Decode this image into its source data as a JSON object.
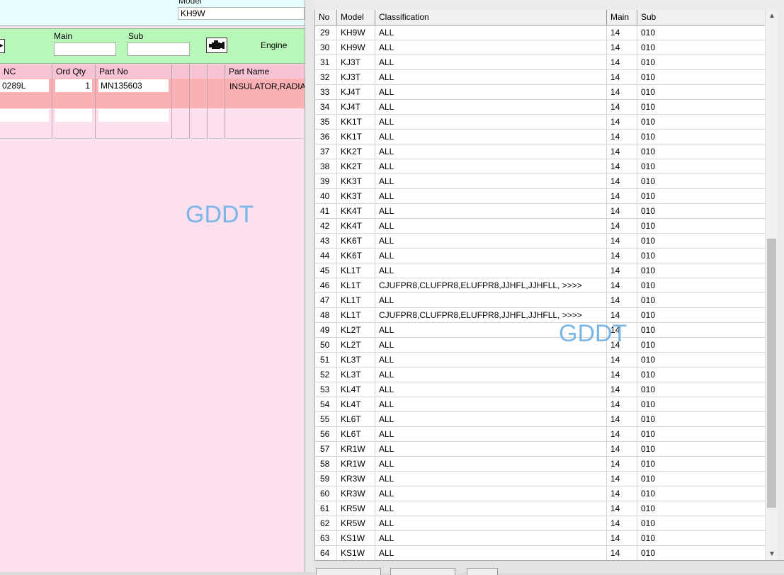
{
  "left": {
    "model_label": "Model",
    "model_value": "KH9W",
    "main_label": "Main",
    "sub_label": "Sub",
    "engine_label": "Engine",
    "watermark": "GDDT",
    "parts_header": {
      "pnc": "NC",
      "ord_qty": "Ord Qty",
      "part_no": "Part No",
      "part_name": "Part Name"
    },
    "part_row": {
      "pnc": "0289L",
      "ord_qty": "1",
      "part_no": "MN135603",
      "part_name": "INSULATOR,RADIATOR"
    }
  },
  "grid": {
    "headers": {
      "no": "No",
      "model": "Model",
      "classification": "Classification",
      "main": "Main",
      "sub": "Sub"
    },
    "watermark": "GDDT",
    "rows": [
      {
        "no": "29",
        "model": "KH9W",
        "classification": "ALL",
        "main": "14",
        "sub": "010"
      },
      {
        "no": "30",
        "model": "KH9W",
        "classification": "ALL",
        "main": "14",
        "sub": "010"
      },
      {
        "no": "31",
        "model": "KJ3T",
        "classification": "ALL",
        "main": "14",
        "sub": "010"
      },
      {
        "no": "32",
        "model": "KJ3T",
        "classification": "ALL",
        "main": "14",
        "sub": "010"
      },
      {
        "no": "33",
        "model": "KJ4T",
        "classification": "ALL",
        "main": "14",
        "sub": "010"
      },
      {
        "no": "34",
        "model": "KJ4T",
        "classification": "ALL",
        "main": "14",
        "sub": "010"
      },
      {
        "no": "35",
        "model": "KK1T",
        "classification": "ALL",
        "main": "14",
        "sub": "010"
      },
      {
        "no": "36",
        "model": "KK1T",
        "classification": "ALL",
        "main": "14",
        "sub": "010"
      },
      {
        "no": "37",
        "model": "KK2T",
        "classification": "ALL",
        "main": "14",
        "sub": "010"
      },
      {
        "no": "38",
        "model": "KK2T",
        "classification": "ALL",
        "main": "14",
        "sub": "010"
      },
      {
        "no": "39",
        "model": "KK3T",
        "classification": "ALL",
        "main": "14",
        "sub": "010"
      },
      {
        "no": "40",
        "model": "KK3T",
        "classification": "ALL",
        "main": "14",
        "sub": "010"
      },
      {
        "no": "41",
        "model": "KK4T",
        "classification": "ALL",
        "main": "14",
        "sub": "010"
      },
      {
        "no": "42",
        "model": "KK4T",
        "classification": "ALL",
        "main": "14",
        "sub": "010"
      },
      {
        "no": "43",
        "model": "KK6T",
        "classification": "ALL",
        "main": "14",
        "sub": "010"
      },
      {
        "no": "44",
        "model": "KK6T",
        "classification": "ALL",
        "main": "14",
        "sub": "010"
      },
      {
        "no": "45",
        "model": "KL1T",
        "classification": "ALL",
        "main": "14",
        "sub": "010"
      },
      {
        "no": "46",
        "model": "KL1T",
        "classification": "CJUFPR8,CLUFPR8,ELUFPR8,JJHFL,JJHFLL,  >>>>",
        "main": "14",
        "sub": "010"
      },
      {
        "no": "47",
        "model": "KL1T",
        "classification": "ALL",
        "main": "14",
        "sub": "010"
      },
      {
        "no": "48",
        "model": "KL1T",
        "classification": "CJUFPR8,CLUFPR8,ELUFPR8,JJHFL,JJHFLL,  >>>>",
        "main": "14",
        "sub": "010"
      },
      {
        "no": "49",
        "model": "KL2T",
        "classification": "ALL",
        "main": "14",
        "sub": "010"
      },
      {
        "no": "50",
        "model": "KL2T",
        "classification": "ALL",
        "main": "14",
        "sub": "010"
      },
      {
        "no": "51",
        "model": "KL3T",
        "classification": "ALL",
        "main": "14",
        "sub": "010"
      },
      {
        "no": "52",
        "model": "KL3T",
        "classification": "ALL",
        "main": "14",
        "sub": "010"
      },
      {
        "no": "53",
        "model": "KL4T",
        "classification": "ALL",
        "main": "14",
        "sub": "010"
      },
      {
        "no": "54",
        "model": "KL4T",
        "classification": "ALL",
        "main": "14",
        "sub": "010"
      },
      {
        "no": "55",
        "model": "KL6T",
        "classification": "ALL",
        "main": "14",
        "sub": "010"
      },
      {
        "no": "56",
        "model": "KL6T",
        "classification": "ALL",
        "main": "14",
        "sub": "010"
      },
      {
        "no": "57",
        "model": "KR1W",
        "classification": "ALL",
        "main": "14",
        "sub": "010"
      },
      {
        "no": "58",
        "model": "KR1W",
        "classification": "ALL",
        "main": "14",
        "sub": "010"
      },
      {
        "no": "59",
        "model": "KR3W",
        "classification": "ALL",
        "main": "14",
        "sub": "010"
      },
      {
        "no": "60",
        "model": "KR3W",
        "classification": "ALL",
        "main": "14",
        "sub": "010"
      },
      {
        "no": "61",
        "model": "KR5W",
        "classification": "ALL",
        "main": "14",
        "sub": "010"
      },
      {
        "no": "62",
        "model": "KR5W",
        "classification": "ALL",
        "main": "14",
        "sub": "010"
      },
      {
        "no": "63",
        "model": "KS1W",
        "classification": "ALL",
        "main": "14",
        "sub": "010"
      },
      {
        "no": "64",
        "model": "KS1W",
        "classification": "ALL",
        "main": "14",
        "sub": "010"
      }
    ]
  },
  "icons": {
    "arrow": "arrow-right-icon",
    "engine": "engine-icon",
    "scroll_up": "chevron-up-icon",
    "scroll_down": "chevron-down-icon"
  },
  "colors": {
    "pink_bg": "#fde0ee",
    "green_bar": "#b8f7b8",
    "selected_row": "#fbb1b4",
    "watermark": "#7ab6e6"
  }
}
